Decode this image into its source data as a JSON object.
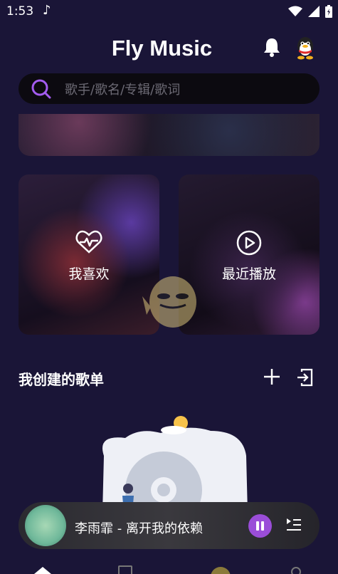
{
  "status": {
    "time": "1:53",
    "note_icon": "music-note-icon",
    "icons": [
      "wifi-icon",
      "signal-icon",
      "battery-icon"
    ]
  },
  "header": {
    "title": "Fly Music",
    "bell_icon": "bell-icon",
    "avatar_icon": "qq-penguin-icon"
  },
  "search": {
    "placeholder": "歌手/歌名/专辑/歌词"
  },
  "cards": [
    {
      "label": "我喜欢",
      "icon": "heart-pulse-icon"
    },
    {
      "label": "最近播放",
      "icon": "play-circle-icon"
    }
  ],
  "playlists": {
    "title": "我创建的歌单"
  },
  "player": {
    "song": "李雨霏 - 离开我的依赖",
    "accent": "#9a4dd8"
  },
  "nav": [
    "home-icon",
    "document-icon",
    "avatar-icon",
    "search-icon"
  ]
}
